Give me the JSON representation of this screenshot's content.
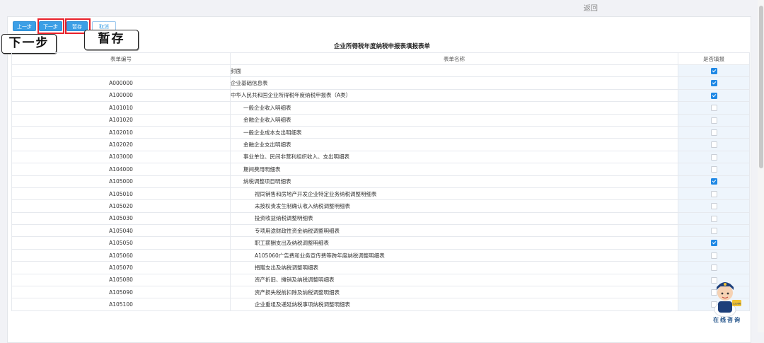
{
  "header": {
    "back_label": "返回"
  },
  "toolbar": {
    "prev_label": "上一步",
    "next_label": "下一步",
    "save_label": "暂存",
    "cancel_label": "取消"
  },
  "callouts": {
    "next": "下一步",
    "save": "暂存"
  },
  "form": {
    "title": "企业所得税年度纳税申报表填报表单",
    "columns": [
      "表单编号",
      "表单名称",
      "是否填报"
    ],
    "rows": [
      {
        "code": "",
        "name": "封面",
        "checked": true,
        "indent": 0
      },
      {
        "code": "A000000",
        "name": "企业基础信息表",
        "checked": true,
        "indent": 0
      },
      {
        "code": "A100000",
        "name": "中华人民共和国企业所得税年度纳税申报表（A类）",
        "checked": true,
        "indent": 0
      },
      {
        "code": "A101010",
        "name": "一般企业收入明细表",
        "checked": false,
        "indent": 1
      },
      {
        "code": "A101020",
        "name": "金融企业收入明细表",
        "checked": false,
        "indent": 1
      },
      {
        "code": "A102010",
        "name": "一般企业成本支出明细表",
        "checked": false,
        "indent": 1
      },
      {
        "code": "A102020",
        "name": "金融企业支出明细表",
        "checked": false,
        "indent": 1
      },
      {
        "code": "A103000",
        "name": "事业单位、民间非营利组织收入、支出明细表",
        "checked": false,
        "indent": 1
      },
      {
        "code": "A104000",
        "name": "期间费用明细表",
        "checked": false,
        "indent": 1
      },
      {
        "code": "A105000",
        "name": "纳税调整项目明细表",
        "checked": true,
        "indent": 1
      },
      {
        "code": "A105010",
        "name": "视同销售和房地产开发企业特定业务纳税调整明细表",
        "checked": false,
        "indent": 2
      },
      {
        "code": "A105020",
        "name": "未按权责发生制确认收入纳税调整明细表",
        "checked": false,
        "indent": 2
      },
      {
        "code": "A105030",
        "name": "投资收益纳税调整明细表",
        "checked": false,
        "indent": 2
      },
      {
        "code": "A105040",
        "name": "专项用途财政性资金纳税调整明细表",
        "checked": false,
        "indent": 2
      },
      {
        "code": "A105050",
        "name": "职工薪酬支出及纳税调整明细表",
        "checked": true,
        "indent": 2
      },
      {
        "code": "A105060",
        "name": "A105060广告费和业务宣传费等跨年度纳税调整明细表",
        "checked": false,
        "indent": 2
      },
      {
        "code": "A105070",
        "name": "捐赠支出及纳税调整明细表",
        "checked": false,
        "indent": 2
      },
      {
        "code": "A105080",
        "name": "资产折旧、摊销及纳税调整明细表",
        "checked": false,
        "indent": 2
      },
      {
        "code": "A105090",
        "name": "资产损失税前扣除及纳税调整明细表",
        "checked": false,
        "indent": 2
      },
      {
        "code": "A105100",
        "name": "企业重组及递延纳税事项纳税调整明细表",
        "checked": false,
        "indent": 2
      }
    ]
  },
  "mascot": {
    "label": "在线咨询",
    "badge": "12366"
  },
  "colors": {
    "accent": "#3c9fe6",
    "highlight": "#e8202a",
    "check": "#1e88e5"
  }
}
